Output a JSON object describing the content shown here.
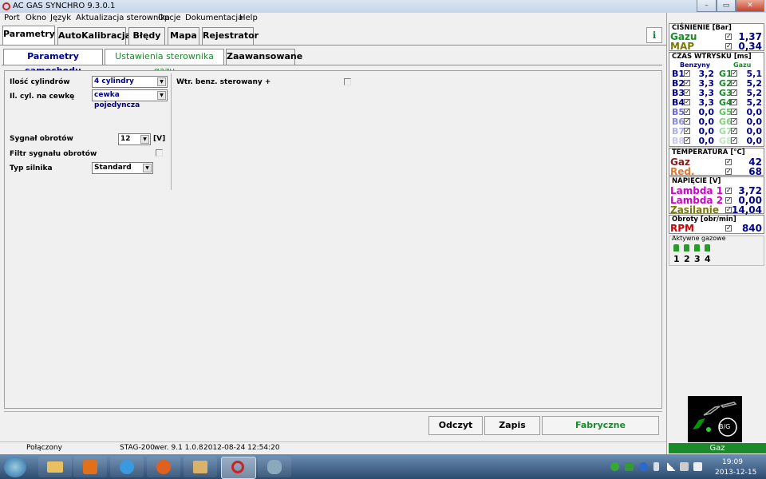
{
  "window": {
    "title": "AC GAS SYNCHRO  9.3.0.1",
    "buttons": {
      "min": "–",
      "max": "▭",
      "close": "✕"
    }
  },
  "menu": [
    "Port",
    "Okno",
    "Język",
    "Aktualizacja sterownika",
    "Opcje",
    "Dokumentacja",
    "Help"
  ],
  "tabs": [
    "Parametry",
    "AutoKalibracja",
    "Błędy",
    "Mapa",
    "Rejestrator"
  ],
  "info_button": "ℹ",
  "subtabs": [
    "Parametry samochodu",
    "Ustawienia sterownika gazu",
    "Zaawansowane"
  ],
  "fields": {
    "cylinders": {
      "label": "Ilość cylindrów",
      "value": "4 cylindry"
    },
    "cyl_per_coil": {
      "label": "Il. cyl. na cewkę",
      "value": "cewka pojedyncza"
    },
    "rpm_signal": {
      "label": "Sygnał obrotów",
      "value": "12",
      "unit": "[V]"
    },
    "rpm_filter": {
      "label": "Filtr sygnału obrotów"
    },
    "engine_type": {
      "label": "Typ silnika",
      "value": "Standard"
    },
    "petrol_injector": {
      "label": "Wtr. benz. sterowany +"
    }
  },
  "buttons": {
    "read": "Odczyt",
    "write": "Zapis",
    "factory": "Fabryczne"
  },
  "status": {
    "connection": "Połączony",
    "device": "STAG-200",
    "version": "wer. 9.1  1.0.8",
    "datetime": "2012-08-24 12:54:20"
  },
  "right": {
    "pressure": {
      "title": "CIŚNIENIE [Bar]",
      "gas_label": "Gazu",
      "gas_value": "1,37",
      "map_label": "MAP",
      "map_value": "0,34"
    },
    "injection": {
      "title": "CZAS WTRYSKU  [ms]",
      "petrol_header": "Benzyny",
      "gas_header": "Gazu",
      "rows": [
        {
          "b": "B1",
          "bv": "3,2",
          "g": "G1",
          "gv": "5,1"
        },
        {
          "b": "B2",
          "bv": "3,3",
          "g": "G2",
          "gv": "5,2"
        },
        {
          "b": "B3",
          "bv": "3,3",
          "g": "G3",
          "gv": "5,2"
        },
        {
          "b": "B4",
          "bv": "3,3",
          "g": "G4",
          "gv": "5,2"
        },
        {
          "b": "B5",
          "bv": "0,0",
          "g": "G5",
          "gv": "0,0"
        },
        {
          "b": "B6",
          "bv": "0,0",
          "g": "G6",
          "gv": "0,0"
        },
        {
          "b": "B7",
          "bv": "0,0",
          "g": "G7",
          "gv": "0,0"
        },
        {
          "b": "B8",
          "bv": "0,0",
          "g": "G8",
          "gv": "0,0"
        }
      ]
    },
    "temperature": {
      "title": "TEMPERATURA  [°C]",
      "gas_label": "Gaz",
      "gas_value": "42",
      "red_label": "Red.",
      "red_value": "68"
    },
    "voltage": {
      "title": "NAPIĘCIE [V]",
      "lambda1_label": "Lambda 1",
      "lambda1_value": "3,72",
      "lambda2_label": "Lambda 2",
      "lambda2_value": "0,00",
      "supply_label": "Zasilanie",
      "supply_value": "14,04"
    },
    "rpm": {
      "title": "Obroty [obr/min]",
      "label": "RPM",
      "value": "840"
    },
    "active_injectors": {
      "title": "Aktywne gazowe",
      "items": [
        "1",
        "2",
        "3",
        "4"
      ]
    },
    "logo_text": "B/G",
    "gas_status": "Gaz"
  },
  "taskbar": {
    "time": "19:09",
    "date": "2013-12-15"
  },
  "colors": {
    "green": "#1a8a2a",
    "navy": "#00008b",
    "red": "#d40000",
    "magenta": "#d000d0",
    "olive": "#7a7a00",
    "brown": "#8b1a1a",
    "orange": "#e07a30"
  }
}
